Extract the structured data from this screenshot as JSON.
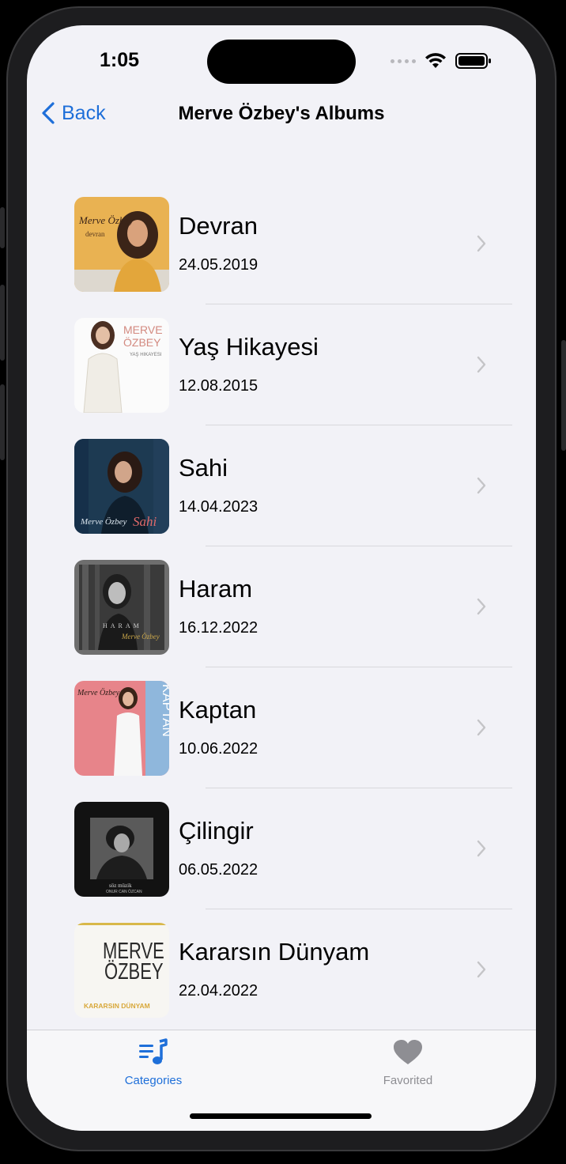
{
  "status_bar": {
    "time": "1:05"
  },
  "nav": {
    "back_label": "Back",
    "title": "Merve Özbey's Albums"
  },
  "albums": [
    {
      "title": "Devran",
      "date": "24.05.2019",
      "cover_text": "Merve Özbey devran"
    },
    {
      "title": "Yaş Hikayesi",
      "date": "12.08.2015",
      "cover_text": "MERVE ÖZBEY YAŞ HIKAYESI"
    },
    {
      "title": "Sahi",
      "date": "14.04.2023",
      "cover_text": "Merve Özbey Sahi"
    },
    {
      "title": "Haram",
      "date": "16.12.2022",
      "cover_text": "HARAM Merve Özbey"
    },
    {
      "title": "Kaptan",
      "date": "10.06.2022",
      "cover_text": "Merve Özbey KAPTAN"
    },
    {
      "title": "Çilingir",
      "date": "06.05.2022",
      "cover_text": "söz müzik ONUR CAN ÖZCAN"
    },
    {
      "title": "Kararsın Dünyam",
      "date": "22.04.2022",
      "cover_text": "MERVE ÖZBEY KARARSIN DÜNYAM"
    }
  ],
  "tabs": [
    {
      "label": "Categories",
      "icon": "music-list-icon",
      "active": true
    },
    {
      "label": "Favorited",
      "icon": "heart-icon",
      "active": false
    }
  ],
  "colors": {
    "accent": "#1e6fd9",
    "inactive_tab": "#8e8e93",
    "background": "#f2f2f7"
  }
}
